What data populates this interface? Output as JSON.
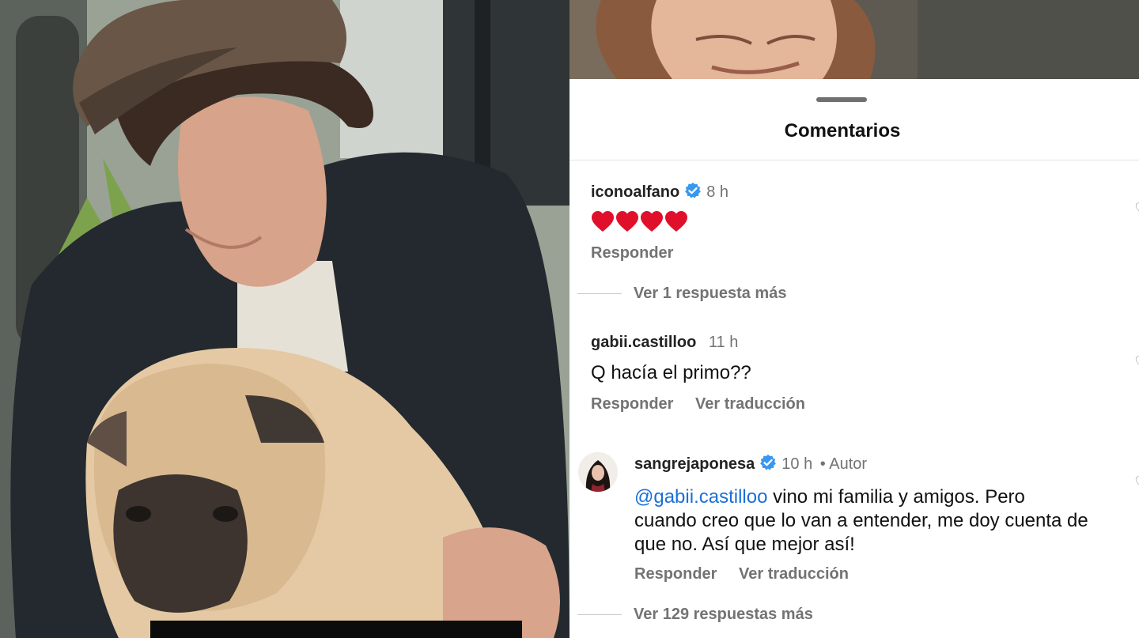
{
  "header": {
    "title": "Comentarios"
  },
  "comments": [
    {
      "username": "iconoalfano",
      "verified": true,
      "time": "8 h",
      "text": "❤️❤️❤️❤️",
      "reply_label": "Responder",
      "more_replies": "Ver 1 respuesta más"
    },
    {
      "username": "gabii.castilloo",
      "verified": false,
      "time": "11 h",
      "text": "Q hacía el primo??",
      "reply_label": "Responder",
      "translate_label": "Ver traducción"
    }
  ],
  "reply": {
    "username": "sangrejaponesa",
    "verified": true,
    "time": "10 h",
    "author_badge": "• Autor",
    "mention": "@gabii.castilloo",
    "text_line1": " vino mi familia y amigos. Pero",
    "text_line2": "cuando creo que lo van a entender, me doy cuenta de",
    "text_line3": "que no. Así que mejor así!",
    "reply_label": "Responder",
    "translate_label": "Ver traducción",
    "more_replies": "Ver 129 respuestas más"
  },
  "colors": {
    "verified_blue": "#3897f0",
    "mention_blue": "#1b6fd8",
    "secondary_text": "#737373"
  }
}
